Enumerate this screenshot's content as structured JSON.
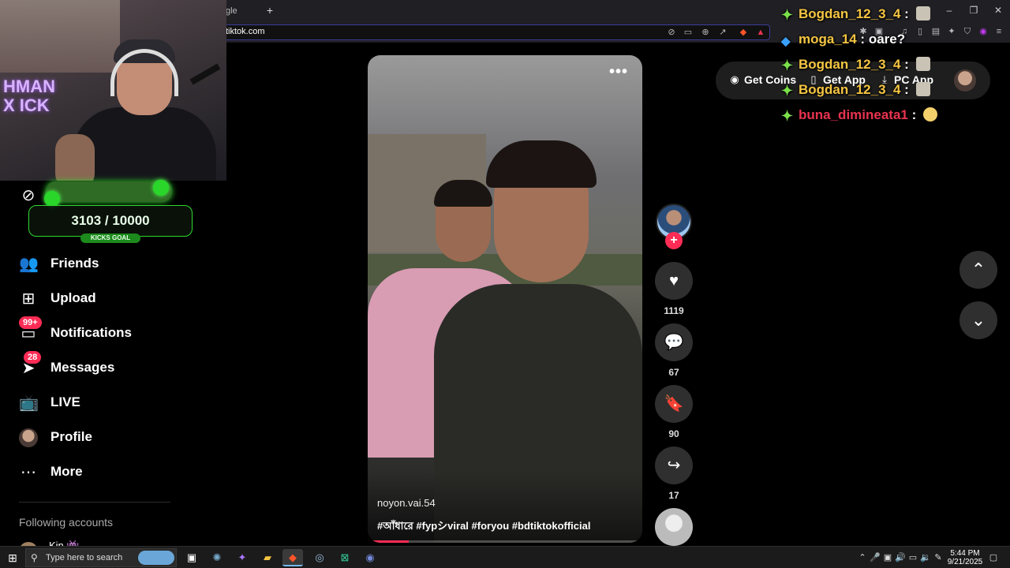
{
  "browser": {
    "tab_title": "gle",
    "new_tab_label": "+",
    "url": "tiktok.com",
    "window_controls": {
      "minimize": "–",
      "restore": "❐",
      "close": "✕"
    }
  },
  "webcam": {
    "neon_text": "HMAN X ICK"
  },
  "kicks_goal": {
    "progress_text": "3103  / 10000",
    "current": 3103,
    "target": 10000,
    "label": "KICKS GOAL"
  },
  "sidebar": {
    "items": [
      {
        "label": "Friends",
        "icon": "friends-icon",
        "badge": ""
      },
      {
        "label": "Upload",
        "icon": "upload-icon",
        "badge": ""
      },
      {
        "label": "Notifications",
        "icon": "inbox-icon",
        "badge": "99+"
      },
      {
        "label": "Messages",
        "icon": "send-icon",
        "badge": "28"
      },
      {
        "label": "LIVE",
        "icon": "live-tv-icon",
        "badge": ""
      },
      {
        "label": "Profile",
        "icon": "profile-avatar",
        "badge": ""
      },
      {
        "label": "More",
        "icon": "more-dots-icon",
        "badge": ""
      }
    ],
    "following_title": "Following accounts",
    "following": [
      {
        "name": "Kin 👾"
      }
    ]
  },
  "video": {
    "author": "noyon.vai.54",
    "caption": "#আঁধারে #fypシviral #foryou #bdtiktokofficial",
    "more_label": "•••",
    "progress": 0.15
  },
  "actions": {
    "likes": "1119",
    "comments": "67",
    "saves": "90",
    "shares": "17"
  },
  "header": {
    "get_coins": "Get Coins",
    "get_app": "Get App",
    "pc_app": "PC App"
  },
  "chat": [
    {
      "user": "Bogdan_12_3_4",
      "sep": " : ",
      "message": "",
      "color": "#f5c542",
      "badge": "star",
      "emote": "pic"
    },
    {
      "user": "moga_14",
      "sep": " : ",
      "message": "oare?",
      "color": "#f5c542",
      "badge": "cube",
      "emote": ""
    },
    {
      "user": "Bogdan_12_3_4",
      "sep": " : ",
      "message": "",
      "color": "#f5c542",
      "badge": "star",
      "emote": "pic"
    },
    {
      "user": "Bogdan_12_3_4",
      "sep": " : ",
      "message": "",
      "color": "#f5c542",
      "badge": "star",
      "emote": "pic"
    },
    {
      "user": "buna_dimineata1",
      "sep": " : ",
      "message": "",
      "color": "#e8334f",
      "badge": "star",
      "emote": "face"
    }
  ],
  "taskbar": {
    "search_placeholder": "Type here to search",
    "time": "5:44 PM",
    "date": "9/21/2025"
  },
  "colors": {
    "accent": "#fe2c55",
    "goal_green": "#2fd82f",
    "chat_gold": "#f5c542",
    "chat_red": "#e8334f"
  }
}
